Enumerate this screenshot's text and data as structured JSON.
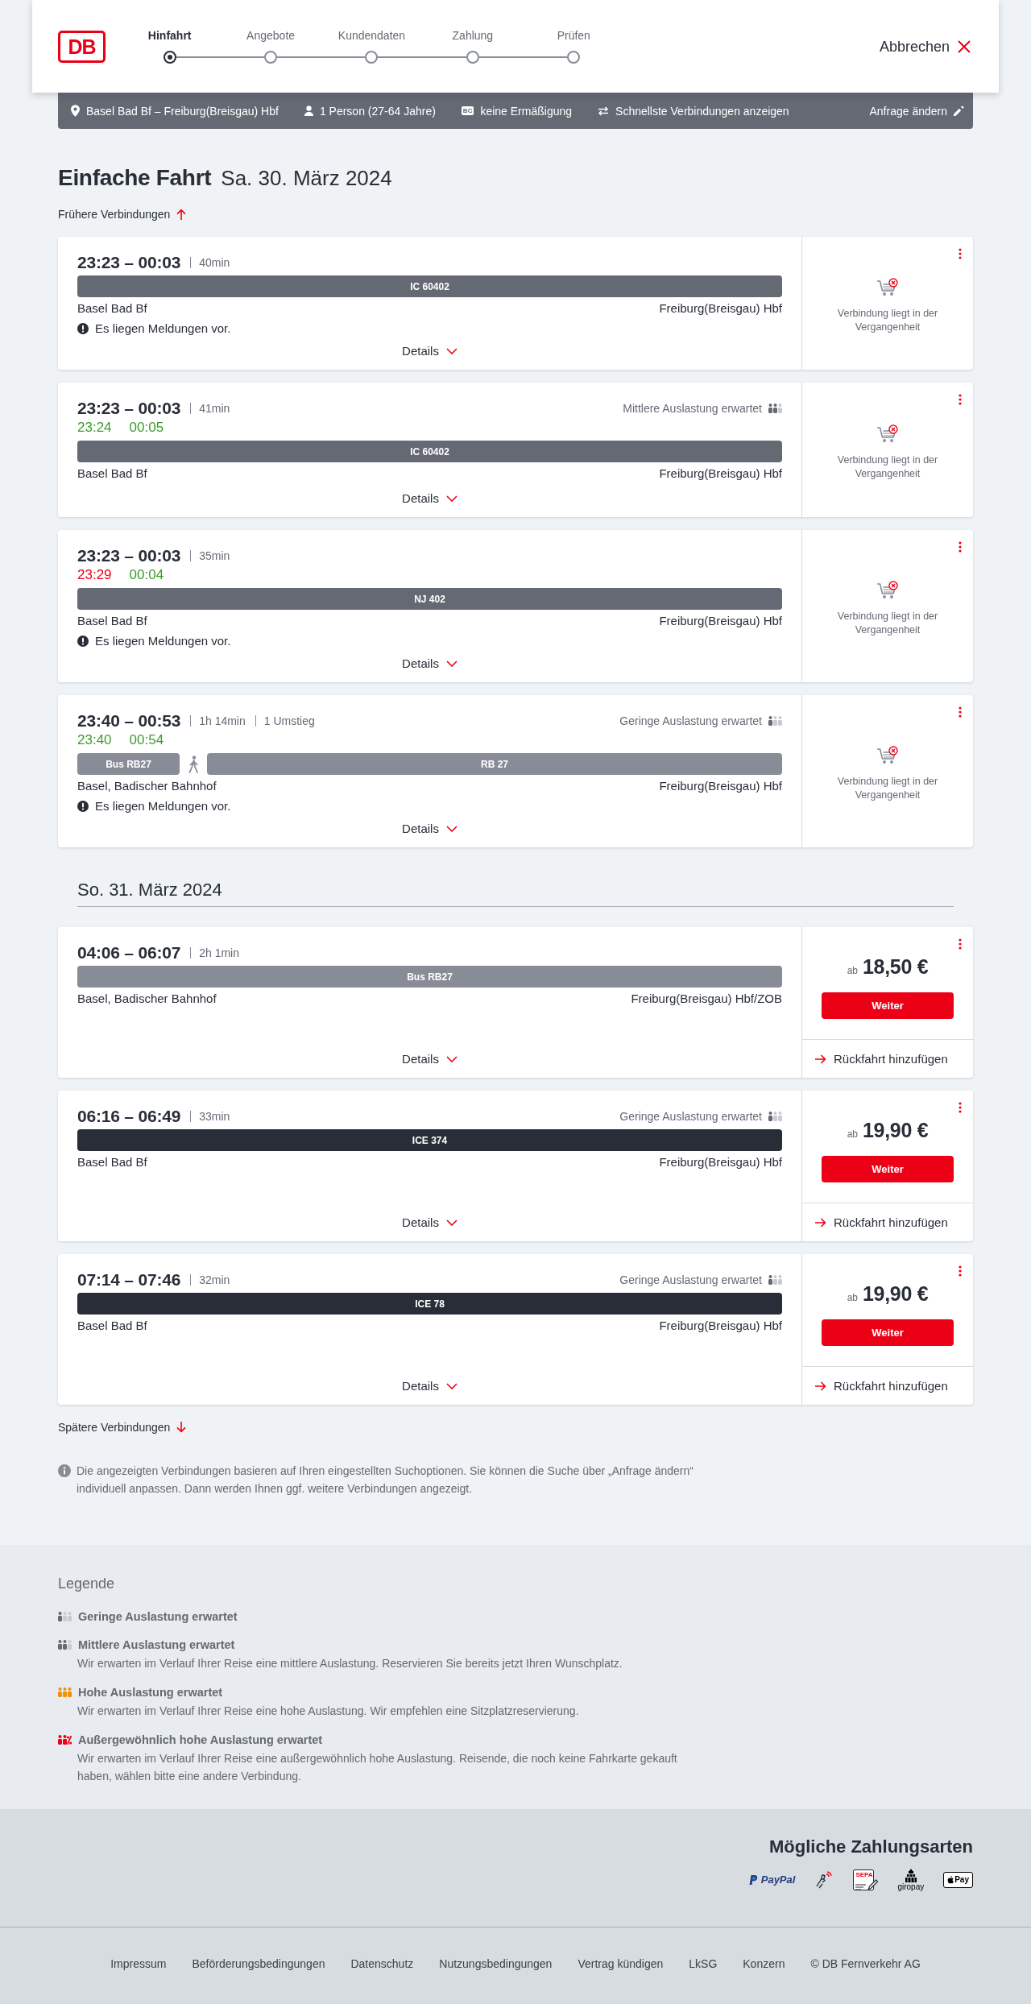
{
  "header": {
    "logo": "DB",
    "steps": [
      {
        "label": "Hinfahrt",
        "selected": true
      },
      {
        "label": "Angebote",
        "selected": false
      },
      {
        "label": "Kundendaten",
        "selected": false
      },
      {
        "label": "Zahlung",
        "selected": false
      },
      {
        "label": "Prüfen",
        "selected": false
      }
    ],
    "cancel": "Abbrechen"
  },
  "search_summary": {
    "items": [
      {
        "kind": "route",
        "text": "Basel Bad Bf – Freiburg(Breisgau) Hbf"
      },
      {
        "kind": "travellers",
        "text": "1 Person (27-64 Jahre)"
      },
      {
        "kind": "discount",
        "badge": "BC",
        "text": "keine Ermäßigung"
      },
      {
        "kind": "options",
        "text": "Schnellste Verbindungen anzeigen"
      }
    ],
    "edit": "Anfrage ändern"
  },
  "title": "Einfache Fahrt",
  "date": "Sa. 30. März 2024",
  "earlier": "Frühere Verbindungen",
  "sections": [
    {
      "connections": [
        {
          "times": "23:23 – 00:03",
          "duration": "40min",
          "segments": [
            {
              "kind": "ic",
              "label": "IC 60402"
            }
          ],
          "from": "Basel Bad Bf",
          "to": "Freiburg(Breisgau) Hbf",
          "message": "Es liegen Meldungen vor.",
          "details": "Details",
          "status": {
            "kind": "past",
            "note": "Verbindung liegt in der Vergangenheit"
          }
        },
        {
          "times": "23:23 – 00:03",
          "duration": "41min",
          "occupancy": {
            "kind": "medium",
            "text": "Mittlere Auslastung erwartet"
          },
          "realtime": [
            {
              "time": "23:24",
              "delayed": false
            },
            {
              "time": "00:05",
              "delayed": false
            }
          ],
          "segments": [
            {
              "kind": "ic",
              "label": "IC 60402"
            }
          ],
          "from": "Basel Bad Bf",
          "to": "Freiburg(Breisgau) Hbf",
          "details": "Details",
          "status": {
            "kind": "past",
            "note": "Verbindung liegt in der Vergangenheit"
          }
        },
        {
          "times": "23:23 – 00:03",
          "duration": "35min",
          "realtime": [
            {
              "time": "23:29",
              "delayed": true
            },
            {
              "time": "00:04",
              "delayed": false
            }
          ],
          "segments": [
            {
              "kind": "ic",
              "label": "NJ 402"
            }
          ],
          "from": "Basel Bad Bf",
          "to": "Freiburg(Breisgau) Hbf",
          "message": "Es liegen Meldungen vor.",
          "details": "Details",
          "status": {
            "kind": "past",
            "note": "Verbindung liegt in der Vergangenheit"
          }
        },
        {
          "times": "23:40 – 00:53",
          "duration": "1h 14min",
          "transfers": "1 Umstieg",
          "occupancy": {
            "kind": "low",
            "text": "Geringe Auslastung erwartet"
          },
          "realtime": [
            {
              "time": "23:40",
              "delayed": false
            },
            {
              "time": "00:54",
              "delayed": false
            }
          ],
          "segments": [
            {
              "kind": "regional",
              "label": "Bus RB27"
            },
            {
              "kind": "walk"
            },
            {
              "kind": "regional",
              "label": "RB 27"
            }
          ],
          "from": "Basel, Badischer Bahnhof",
          "to": "Freiburg(Breisgau) Hbf",
          "message": "Es liegen Meldungen vor.",
          "details": "Details",
          "status": {
            "kind": "past",
            "note": "Verbindung liegt in der Vergangenheit"
          }
        }
      ]
    },
    {
      "heading": "So. 31. März 2024",
      "connections": [
        {
          "times": "04:06 – 06:07",
          "duration": "2h 1min",
          "segments": [
            {
              "kind": "regional",
              "label": "Bus RB27"
            }
          ],
          "from": "Basel, Badischer Bahnhof",
          "to": "Freiburg(Breisgau) Hbf/ZOB",
          "details": "Details",
          "status": {
            "kind": "offer",
            "prefix": "ab",
            "price": "18,50 €",
            "button": "Weiter",
            "return_trip": "Rückfahrt hinzufügen"
          }
        },
        {
          "times": "06:16 – 06:49",
          "duration": "33min",
          "occupancy": {
            "kind": "low",
            "text": "Geringe Auslastung erwartet"
          },
          "segments": [
            {
              "kind": "ice",
              "label": "ICE 374"
            }
          ],
          "from": "Basel Bad Bf",
          "to": "Freiburg(Breisgau) Hbf",
          "details": "Details",
          "status": {
            "kind": "offer",
            "prefix": "ab",
            "price": "19,90 €",
            "button": "Weiter",
            "return_trip": "Rückfahrt hinzufügen"
          }
        },
        {
          "times": "07:14 – 07:46",
          "duration": "32min",
          "occupancy": {
            "kind": "low",
            "text": "Geringe Auslastung erwartet"
          },
          "segments": [
            {
              "kind": "ice",
              "label": "ICE 78"
            }
          ],
          "from": "Basel Bad Bf",
          "to": "Freiburg(Breisgau) Hbf",
          "details": "Details",
          "status": {
            "kind": "offer",
            "prefix": "ab",
            "price": "19,90 €",
            "button": "Weiter",
            "return_trip": "Rückfahrt hinzufügen"
          }
        }
      ]
    }
  ],
  "later": "Spätere Verbindungen",
  "note": "Die angezeigten Verbindungen basieren auf Ihren eingestellten Suchoptionen. Sie können die Suche über „Anfrage ändern“ individuell anpassen. Dann werden Ihnen ggf. weitere Verbindungen angezeigt.",
  "legend": {
    "title": "Legende",
    "items": [
      {
        "kind": "low",
        "title": "Geringe Auslastung erwartet"
      },
      {
        "kind": "medium",
        "title": "Mittlere Auslastung erwartet",
        "description": "Wir erwarten im Verlauf Ihrer Reise eine mittlere Auslastung. Reservieren Sie bereits jetzt Ihren Wunschplatz."
      },
      {
        "kind": "high",
        "title": "Hohe Auslastung erwartet",
        "description": "Wir erwarten im Verlauf Ihrer Reise eine hohe Auslastung. Wir empfehlen eine Sitzplatzreservierung."
      },
      {
        "kind": "extreme",
        "title": "Außergewöhnlich hohe Auslastung erwartet",
        "description": "Wir erwarten im Verlauf Ihrer Reise eine außergewöhnlich hohe Auslastung. Reisende, die noch keine Fahrkarte gekauft haben, wählen bitte eine andere Verbindung."
      }
    ]
  },
  "payment": {
    "title": "Mögliche Zahlungsarten",
    "methods": [
      {
        "kind": "paypal",
        "label": "PayPal"
      },
      {
        "kind": "contactless"
      },
      {
        "kind": "sepa",
        "label": "SEPA"
      },
      {
        "kind": "giropay",
        "label": "giropay"
      },
      {
        "kind": "applepay",
        "label": "Pay"
      }
    ]
  },
  "footer": {
    "links": [
      "Impressum",
      "Beförderungsbedingungen",
      "Datenschutz",
      "Nutzungsbedingungen",
      "Vertrag kündigen",
      "LkSG",
      "Konzern"
    ],
    "copyright": "© DB Fernverkehr AG"
  }
}
